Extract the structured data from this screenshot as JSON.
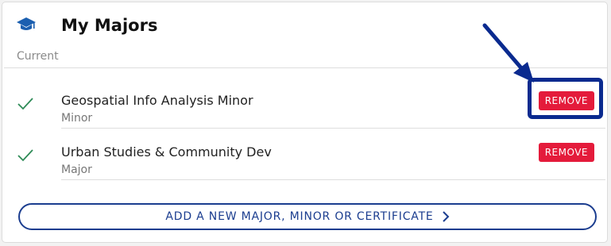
{
  "header": {
    "title": "My Majors",
    "icon": "graduation-cap-icon"
  },
  "section": {
    "label": "Current"
  },
  "items": [
    {
      "name": "Geospatial Info Analysis Minor",
      "type": "Minor",
      "remove_label": "REMOVE",
      "status_icon": "checkmark-icon"
    },
    {
      "name": "Urban Studies & Community Dev",
      "type": "Major",
      "remove_label": "REMOVE",
      "status_icon": "checkmark-icon"
    }
  ],
  "add_button": {
    "label": "ADD A NEW MAJOR, MINOR OR CERTIFICATE",
    "icon": "chevron-right-icon"
  },
  "colors": {
    "brand_blue": "#1b3d8f",
    "remove_red": "#e41b3b",
    "check_green": "#2e8b57",
    "annotation_blue": "#0a2a8f"
  }
}
